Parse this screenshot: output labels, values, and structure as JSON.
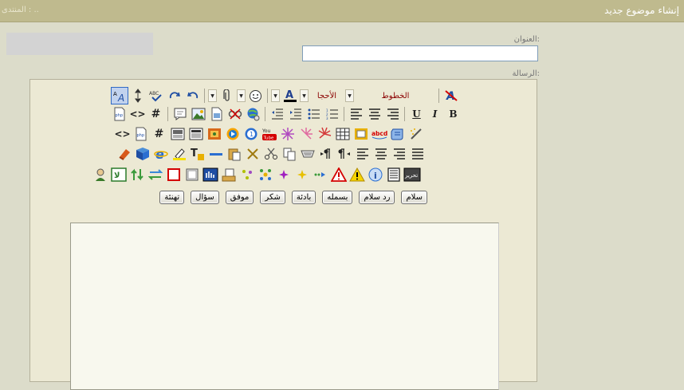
{
  "window": {
    "title": "إنشاء موضوع جديد",
    "breadcrumb": "المنتدى : .."
  },
  "form": {
    "subject_label": "العنوان:",
    "subject_value": "",
    "message_label": "الرسالة:"
  },
  "toolbar": {
    "font_label": "الخطوط",
    "size_label": "الأحجا"
  },
  "quick_buttons": [
    "سلام",
    "رد سلام",
    "بسمله",
    "بادئة",
    "شكر",
    "موفق",
    "سؤال",
    "تهنئة"
  ],
  "icons": {
    "underline": "U",
    "italic": "I",
    "bold": "B",
    "hash": "#",
    "code": "<>",
    "text_a": "A",
    "spell": "ABC",
    "php": "php",
    "abcd": "abcd",
    "youtube": "You",
    "one": "1",
    "info": "i",
    "html": "تحرير",
    "color_red": "#d40000"
  },
  "colors": {
    "header": "#bfba8e",
    "editor_bg": "#ece9d4",
    "textarea_bg": "#f8f8ee"
  }
}
